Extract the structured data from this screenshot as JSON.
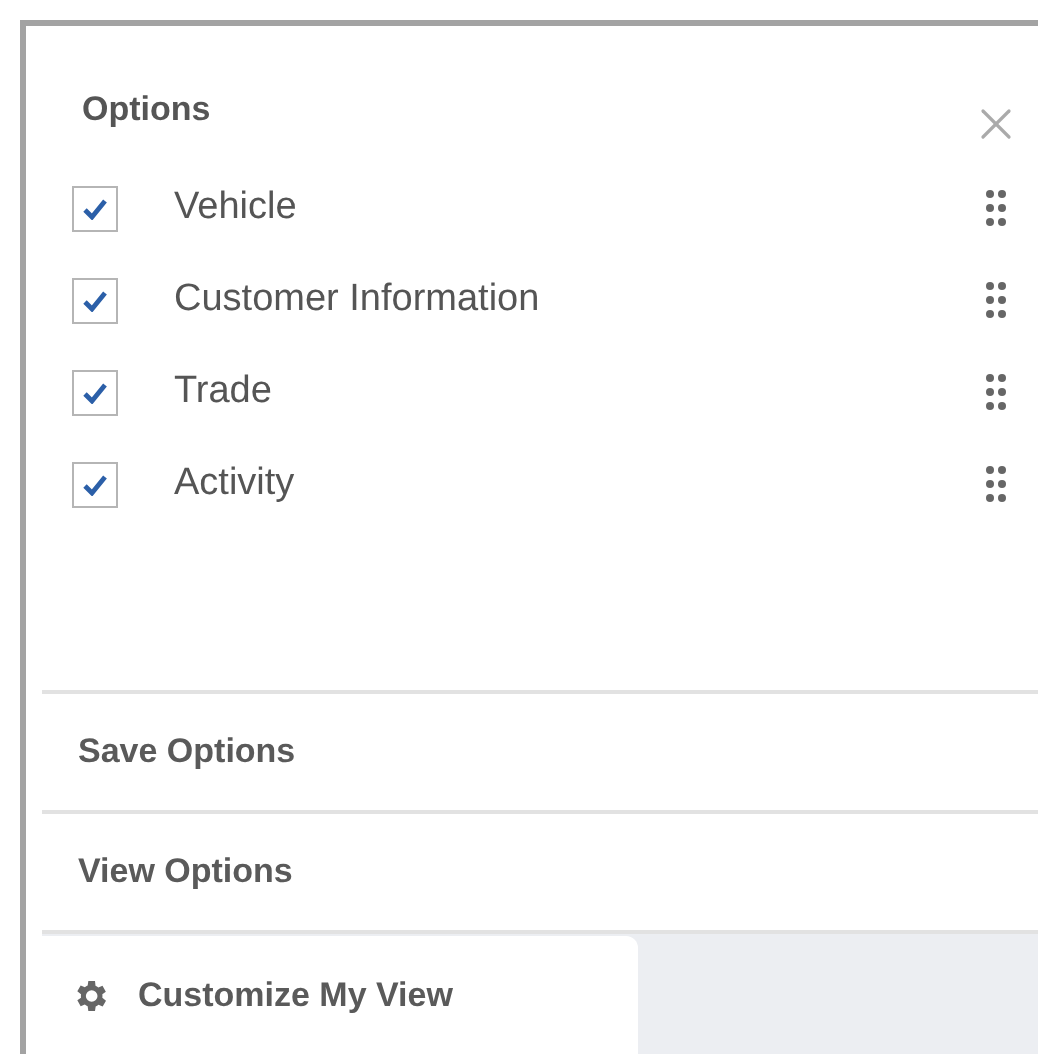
{
  "title": "Options",
  "options": [
    {
      "label": "Vehicle",
      "checked": true
    },
    {
      "label": "Customer Information",
      "checked": true
    },
    {
      "label": "Trade",
      "checked": true
    },
    {
      "label": "Activity",
      "checked": true
    }
  ],
  "sections": [
    "Save Options",
    "View Options"
  ],
  "footer_tab": {
    "label": "Customize My View",
    "selected": true
  }
}
